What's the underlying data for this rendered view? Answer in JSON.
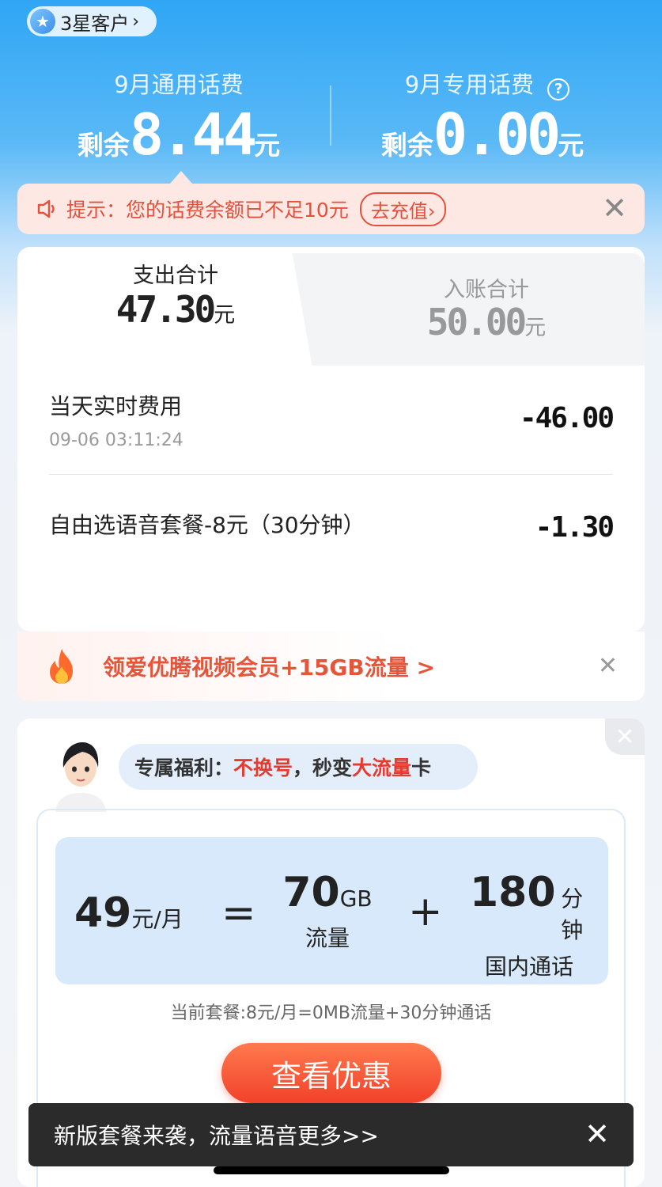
{
  "header": {
    "badge_label": "3星客户",
    "badge_chevron": "›"
  },
  "balances": {
    "general": {
      "title": "9月通用话费",
      "prefix": "剩余",
      "amount": "8.44",
      "unit": "元"
    },
    "special": {
      "title": "9月专用话费",
      "prefix": "剩余",
      "amount": "0.00",
      "unit": "元",
      "help_icon": "?"
    }
  },
  "notice": {
    "text": "提示：您的话费余额已不足10元",
    "button": "去充值›",
    "close": "✕"
  },
  "summary": {
    "expense": {
      "label": "支出合计",
      "amount": "47.30",
      "unit": "元"
    },
    "income": {
      "label": "入账合计",
      "amount": "50.00",
      "unit": "元"
    }
  },
  "records": [
    {
      "title": "当天实时费用",
      "time": "09-06 03:11:24",
      "amount": "-46.00"
    },
    {
      "title": "自由选语音套餐-8元（30分钟）",
      "amount": "-1.30"
    }
  ],
  "promo": {
    "text": "领爱优腾视频会员+15GB流量 >",
    "close": "✕"
  },
  "offer": {
    "bubble_prefix": "专属福利：",
    "bubble_red1": "不换号",
    "bubble_mid": "，秒变",
    "bubble_red2": "大流量",
    "bubble_suffix": "卡",
    "price": "49",
    "price_unit": "元/月",
    "equals": "=",
    "plus": "+",
    "data_amount": "70",
    "data_unit": "GB",
    "data_label": "流量",
    "call_amount": "180",
    "call_unit": "分钟",
    "call_label": "国内通话",
    "current_plan": "当前套餐:8元/月=0MB流量+30分钟通话",
    "cta": "查看优惠",
    "close": "✕"
  },
  "toast": {
    "text": "新版套餐来袭，流量语音更多>>",
    "close": "✕"
  },
  "colors": {
    "accent_red": "#e5503d",
    "cta_red": "#f2412a",
    "header_blue": "#2fa6f5",
    "plan_blue": "#d7e9fb"
  }
}
